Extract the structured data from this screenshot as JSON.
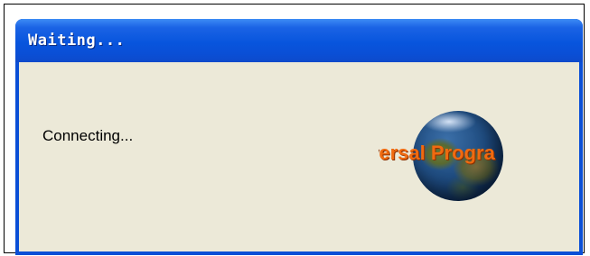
{
  "window": {
    "title": "Waiting..."
  },
  "content": {
    "message": "Connecting...",
    "logo_text": "iversal Progra"
  },
  "colors": {
    "titlebar_blue": "#0a4fd6",
    "client_background": "#ece9d8",
    "logo_text_orange": "#f06a10"
  },
  "icons": {
    "logo": "globe-logo-icon"
  }
}
